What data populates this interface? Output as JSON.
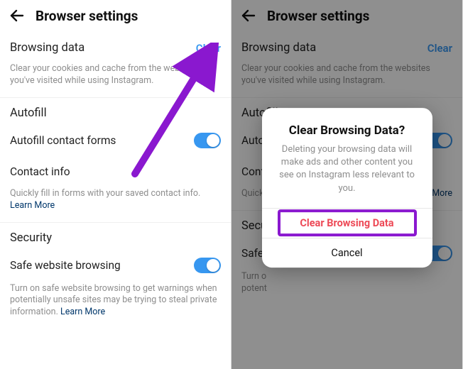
{
  "header": {
    "title": "Browser settings"
  },
  "browsing_data": {
    "label": "Browsing data",
    "action": "Clear",
    "desc": "Clear your cookies and cache from the websites you've visited while using Instagram."
  },
  "autofill": {
    "section": "Autofill",
    "contact_forms": "Autofill contact forms",
    "contact_info": "Contact info",
    "desc_prefix": "Quickly fill in forms with your saved contact info. ",
    "learn_more": "Learn More"
  },
  "security": {
    "section": "Security",
    "safe_browsing": "Safe website browsing",
    "desc_prefix": "Turn on safe website browsing to get warnings when potentially unsafe sites may be trying to steal private information. ",
    "learn_more": "Learn More"
  },
  "right": {
    "autofill_contact_forms_truncated": "Auto",
    "contact_info_truncated": "Cont",
    "autofill_desc_left": "Quickl",
    "autofill_desc_right": "More",
    "security_truncated": "Secu",
    "safe_browsing_truncated": "Safe",
    "security_desc_truncated": "Turn o\npotent"
  },
  "dialog": {
    "title": "Clear Browsing Data?",
    "message": "Deleting your browsing data will make ads and other content you see on Instagram less relevant to you.",
    "confirm": "Clear Browsing Data",
    "cancel": "Cancel"
  },
  "colors": {
    "accent": "#3797f0",
    "destructive": "#ed4956",
    "annotation": "#8a18cf"
  }
}
